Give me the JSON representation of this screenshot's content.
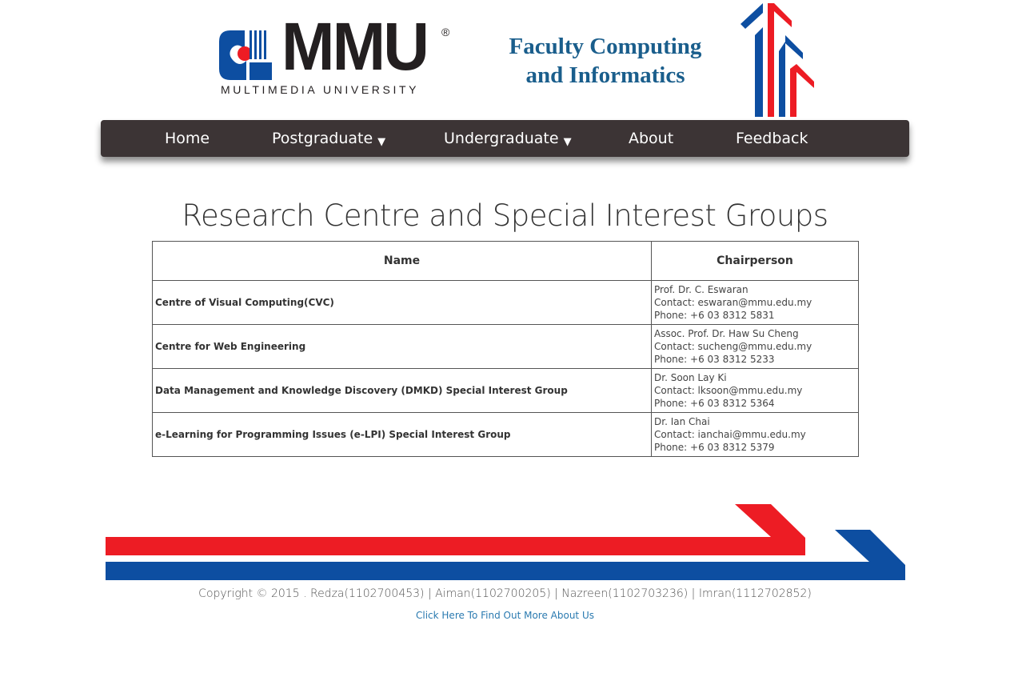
{
  "header": {
    "logo_text": "MMU",
    "logo_registered": "®",
    "logo_subtitle": "MULTIMEDIA UNIVERSITY",
    "faculty_title_line1": "Faculty Computing",
    "faculty_title_line2": "and Informatics"
  },
  "nav": {
    "items": [
      {
        "label": "Home",
        "has_dropdown": false
      },
      {
        "label": "Postgraduate",
        "has_dropdown": true
      },
      {
        "label": "Undergraduate",
        "has_dropdown": true
      },
      {
        "label": "About",
        "has_dropdown": false
      },
      {
        "label": "Feedback",
        "has_dropdown": false
      }
    ],
    "caret_glyph": "▼"
  },
  "main": {
    "title": "Research Centre and Special Interest Groups",
    "table": {
      "headers": [
        "Name",
        "Chairperson"
      ],
      "rows": [
        {
          "name": "Centre of Visual Computing(CVC)",
          "chair_name": "Prof. Dr. C. Eswaran",
          "contact": "Contact: eswaran@mmu.edu.my",
          "phone": "Phone: +6 03 8312 5831"
        },
        {
          "name": "Centre for Web Engineering",
          "chair_name": "Assoc. Prof. Dr. Haw Su Cheng",
          "contact": "Contact: sucheng@mmu.edu.my",
          "phone": "Phone: +6 03 8312 5233"
        },
        {
          "name": "Data Management and Knowledge Discovery (DMKD) Special Interest Group",
          "chair_name": "Dr. Soon Lay Ki",
          "contact": "Contact: lksoon@mmu.edu.my",
          "phone": "Phone: +6 03 8312 5364"
        },
        {
          "name": "e-Learning for Programming Issues (e-LPI) Special Interest Group",
          "chair_name": "Dr. Ian Chai",
          "contact": "Contact: ianchai@mmu.edu.my",
          "phone": "Phone: +6 03 8312 5379"
        }
      ]
    }
  },
  "footer": {
    "copyright": "Copyright © 2015 . Redza(1102700453) | Aiman(1102700205) | Nazreen(1102703236) | Imran(1112702852)",
    "more_link": "Click Here To Find Out More About Us"
  },
  "colors": {
    "nav_bg": "#3c3435",
    "brand_red": "#ed1c24",
    "brand_blue": "#0d4ea1",
    "title_blue": "#1a5e8c",
    "link_blue": "#2a7ab0"
  }
}
